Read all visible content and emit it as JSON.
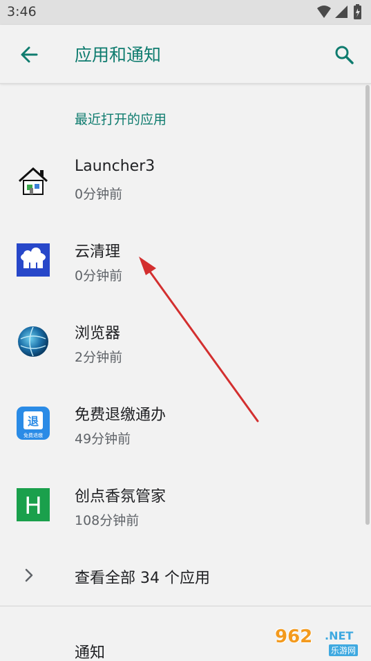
{
  "status_bar": {
    "time": "3:46"
  },
  "app_bar": {
    "title": "应用和通知"
  },
  "recent_section": {
    "header": "最近打开的应用"
  },
  "recent_apps": [
    {
      "name": "Launcher3",
      "time": "0分钟前",
      "icon": "house-icon"
    },
    {
      "name": "云清理",
      "time": "0分钟前",
      "icon": "cloud-cleaner-icon"
    },
    {
      "name": "浏览器",
      "time": "2分钟前",
      "icon": "globe-icon"
    },
    {
      "name": "免费退缴通办",
      "time": "49分钟前",
      "icon": "refund-app-icon",
      "icon_text": "退",
      "icon_caption": "免费退缴"
    },
    {
      "name": "创点香氛管家",
      "time": "108分钟前",
      "icon": "letter-h-icon",
      "icon_text": "H"
    }
  ],
  "see_all": {
    "label": "查看全部 34 个应用"
  },
  "notifications": {
    "label": "通知"
  },
  "watermark": {
    "number": "962",
    "domain": ".NET",
    "caption": "乐游网"
  },
  "colors": {
    "accent": "#0f7c6f",
    "arrow": "#d32f2f",
    "background": "#f2f2f2"
  }
}
